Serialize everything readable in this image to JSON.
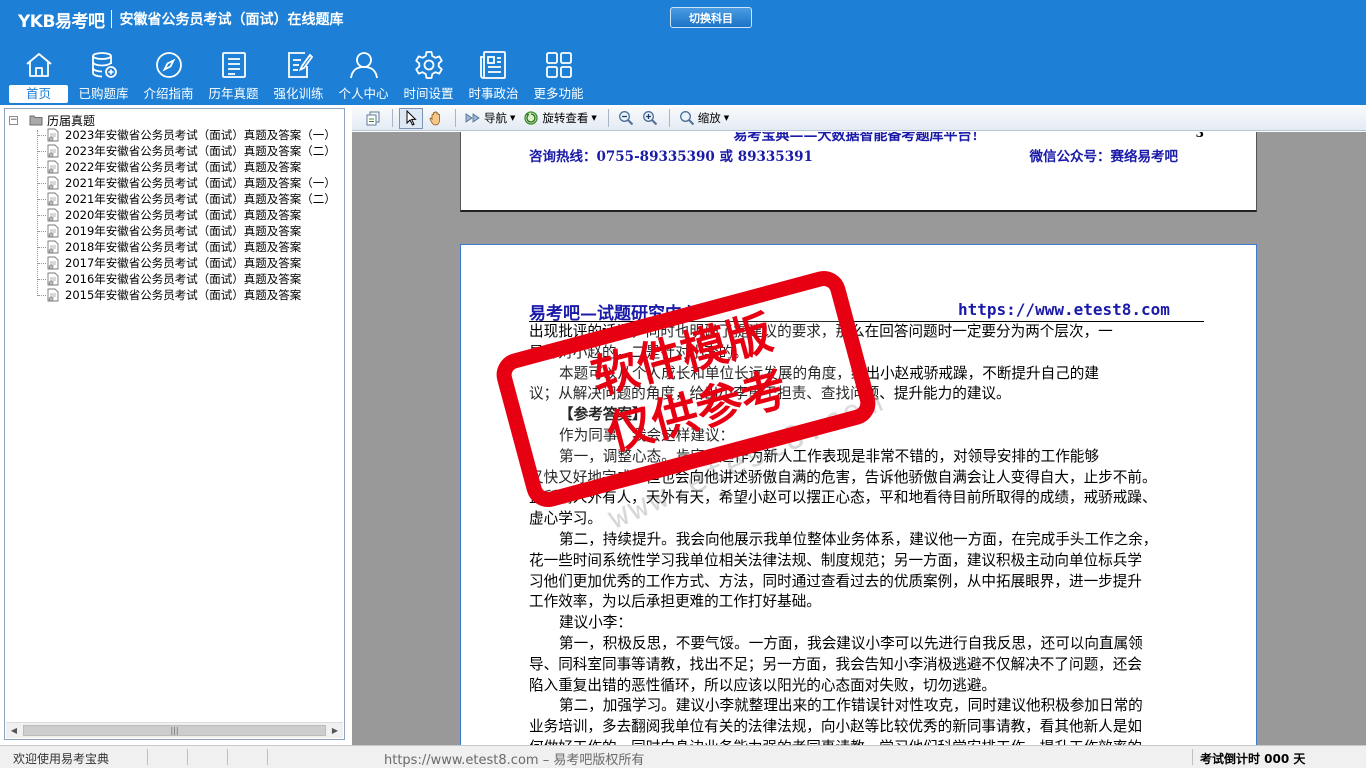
{
  "header": {
    "brand": "YKB易考吧",
    "app_title": "安徽省公务员考试（面试）在线题库",
    "switch_subject_label": "切换科目"
  },
  "nav": [
    {
      "label": "首页",
      "icon": "home-icon",
      "active": true
    },
    {
      "label": "已购题库",
      "icon": "database-icon"
    },
    {
      "label": "介绍指南",
      "icon": "compass-icon"
    },
    {
      "label": "历年真题",
      "icon": "checklist-icon"
    },
    {
      "label": "强化训练",
      "icon": "edit-icon"
    },
    {
      "label": "个人中心",
      "icon": "user-icon"
    },
    {
      "label": "时间设置",
      "icon": "gear-icon"
    },
    {
      "label": "时事政治",
      "icon": "newspaper-icon"
    },
    {
      "label": "更多功能",
      "icon": "grid-icon"
    }
  ],
  "tree": {
    "root_label": "历届真题",
    "items": [
      "2023年安徽省公务员考试（面试）真题及答案（一）",
      "2023年安徽省公务员考试（面试）真题及答案（二）",
      "2022年安徽省公务员考试（面试）真题及答案",
      "2021年安徽省公务员考试（面试）真题及答案（一）",
      "2021年安徽省公务员考试（面试）真题及答案（二）",
      "2020年安徽省公务员考试（面试）真题及答案",
      "2019年安徽省公务员考试（面试）真题及答案",
      "2018年安徽省公务员考试（面试）真题及答案",
      "2017年安徽省公务员考试（面试）真题及答案",
      "2016年安徽省公务员考试（面试）真题及答案",
      "2015年安徽省公务员考试（面试）真题及答案"
    ]
  },
  "toolbar": {
    "nav_label": "导航",
    "rotate_label": "旋转查看",
    "zoom_label": "缩放"
  },
  "document": {
    "prev_page": {
      "motto": "易考宝典——大数据智能备考题库平台！",
      "page_number": "3",
      "hotline": "咨询热线：0755-89335390 或 89335391",
      "wechat": "微信公众号：赛络易考吧"
    },
    "page": {
      "header_left": "易考吧—试题研究中心",
      "header_right": "https://www.etest8.com",
      "lines": [
        {
          "text": "出现批评的话语，同时也明确了提建议的要求，那么在回答问题时一定要分为两个层次，一",
          "indent": false,
          "bold": false
        },
        {
          "text": "是针对小赵的，二是针对小李的。",
          "indent": false,
          "bold": false
        },
        {
          "text": "本题可以从个人成长和单位长远发展的角度，给出小赵戒骄戒躁，不断提升自己的建",
          "indent": true,
          "bold": false
        },
        {
          "text": "议；从解决问题的角度，给出小李勇于担责、查找问题、提升能力的建议。",
          "indent": false,
          "bold": false
        },
        {
          "text": "【参考答案】",
          "indent": true,
          "bold": true
        },
        {
          "text": "作为同事，我会这样建议：",
          "indent": true,
          "bold": false
        },
        {
          "text": "第一，调整心态。肯定小赵作为新人工作表现是非常不错的，对领导安排的工作能够",
          "indent": true,
          "bold": false
        },
        {
          "text": "又快又好地完成，但也会向他讲述骄傲自满的危害，告诉他骄傲自满会让人变得自大，止步不前。",
          "indent": false,
          "bold": false
        },
        {
          "text": "正所谓人外有人，天外有天，希望小赵可以摆正心态，平和地看待目前所取得的成绩，戒骄戒躁、",
          "indent": false,
          "bold": false
        },
        {
          "text": "虚心学习。",
          "indent": false,
          "bold": false
        },
        {
          "text": "第二，持续提升。我会向他展示我单位整体业务体系，建议他一方面，在完成手头工作之余，",
          "indent": true,
          "bold": false
        },
        {
          "text": "花一些时间系统性学习我单位相关法律法规、制度规范；另一方面，建议积极主动向单位标兵学",
          "indent": false,
          "bold": false
        },
        {
          "text": "习他们更加优秀的工作方式、方法，同时通过查看过去的优质案例，从中拓展眼界，进一步提升",
          "indent": false,
          "bold": false
        },
        {
          "text": "工作效率，为以后承担更难的工作打好基础。",
          "indent": false,
          "bold": false
        },
        {
          "text": "建议小李：",
          "indent": true,
          "bold": false
        },
        {
          "text": "第一，积极反思，不要气馁。一方面，我会建议小李可以先进行自我反思，还可以向直属领",
          "indent": true,
          "bold": false
        },
        {
          "text": "导、同科室同事等请教，找出不足；另一方面，我会告知小李消极逃避不仅解决不了问题，还会",
          "indent": false,
          "bold": false
        },
        {
          "text": "陷入重复出错的恶性循环，所以应该以阳光的心态面对失败，切勿逃避。",
          "indent": false,
          "bold": false
        },
        {
          "text": "第二，加强学习。建议小李就整理出来的工作错误针对性攻克，同时建议他积极参加日常的",
          "indent": true,
          "bold": false
        },
        {
          "text": "业务培训，多去翻阅我单位有关的法律法规，向小赵等比较优秀的新同事请教，看其他新人是如",
          "indent": false,
          "bold": false
        },
        {
          "text": "何做好工作的，同时向身边业务能力强的老同事请教，学习他们科学安排工作、提升工作效率的",
          "indent": false,
          "bold": false
        }
      ],
      "watermark": "www.etest8.com"
    },
    "stamp": {
      "line1": "软件模版",
      "line2": "仅供参考",
      "color": "#e60012"
    }
  },
  "statusbar": {
    "welcome": "欢迎使用易考宝典",
    "copyright": "https://www.etest8.com – 易考吧版权所有",
    "timer": "考试倒计时 000 天"
  },
  "colors": {
    "header_bg": "#1d80d6",
    "document_blue": "#1a1aa8",
    "stamp_red": "#e60012"
  }
}
